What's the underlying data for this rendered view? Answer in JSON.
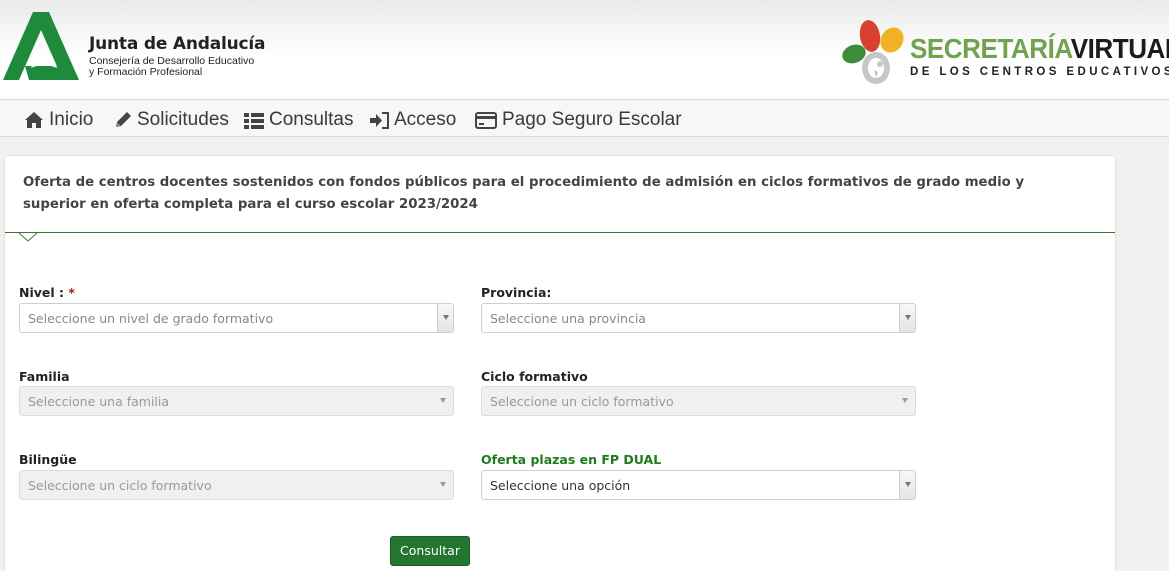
{
  "header": {
    "org_title": "Junta de Andalucía",
    "org_sub1": "Consejería de Desarrollo Educativo",
    "org_sub2": "y Formación Profesional",
    "sv_part1": "SECRETARÍA",
    "sv_part2": "VIRTUAL",
    "sv_sub": "DE LOS CENTROS EDUCATIVOS",
    "colors": {
      "andalucia_green": "#1e8a3c",
      "sv_green": "#71a24f"
    }
  },
  "nav": {
    "items": [
      {
        "label": "Inicio",
        "icon": "home-icon"
      },
      {
        "label": "Solicitudes",
        "icon": "pencil-icon"
      },
      {
        "label": "Consultas",
        "icon": "list-icon"
      },
      {
        "label": "Acceso",
        "icon": "sign-in-icon"
      },
      {
        "label": "Pago Seguro Escolar",
        "icon": "credit-card-icon"
      }
    ]
  },
  "panel": {
    "title": "Oferta de centros docentes sostenidos con fondos públicos para el procedimiento de admisión en ciclos formativos de grado medio y superior en oferta completa para el curso escolar 2023/2024"
  },
  "form": {
    "nivel": {
      "label": "Nivel : ",
      "required_mark": "*",
      "placeholder": "Seleccione un nivel de grado formativo"
    },
    "provincia": {
      "label": "Provincia:",
      "placeholder": "Seleccione una provincia"
    },
    "familia": {
      "label": "Familia",
      "placeholder": "Seleccione una familia"
    },
    "ciclo": {
      "label": "Ciclo formativo",
      "placeholder": "Seleccione un ciclo formativo"
    },
    "bilingue": {
      "label": "Bilingüe",
      "placeholder": "Seleccione un ciclo formativo"
    },
    "dual": {
      "label": "Oferta plazas en FP DUAL",
      "value": "Seleccione una opción"
    },
    "submit_label": "Consultar",
    "colors": {
      "button_green": "#23752f",
      "label_green": "#1d7a1d"
    }
  }
}
